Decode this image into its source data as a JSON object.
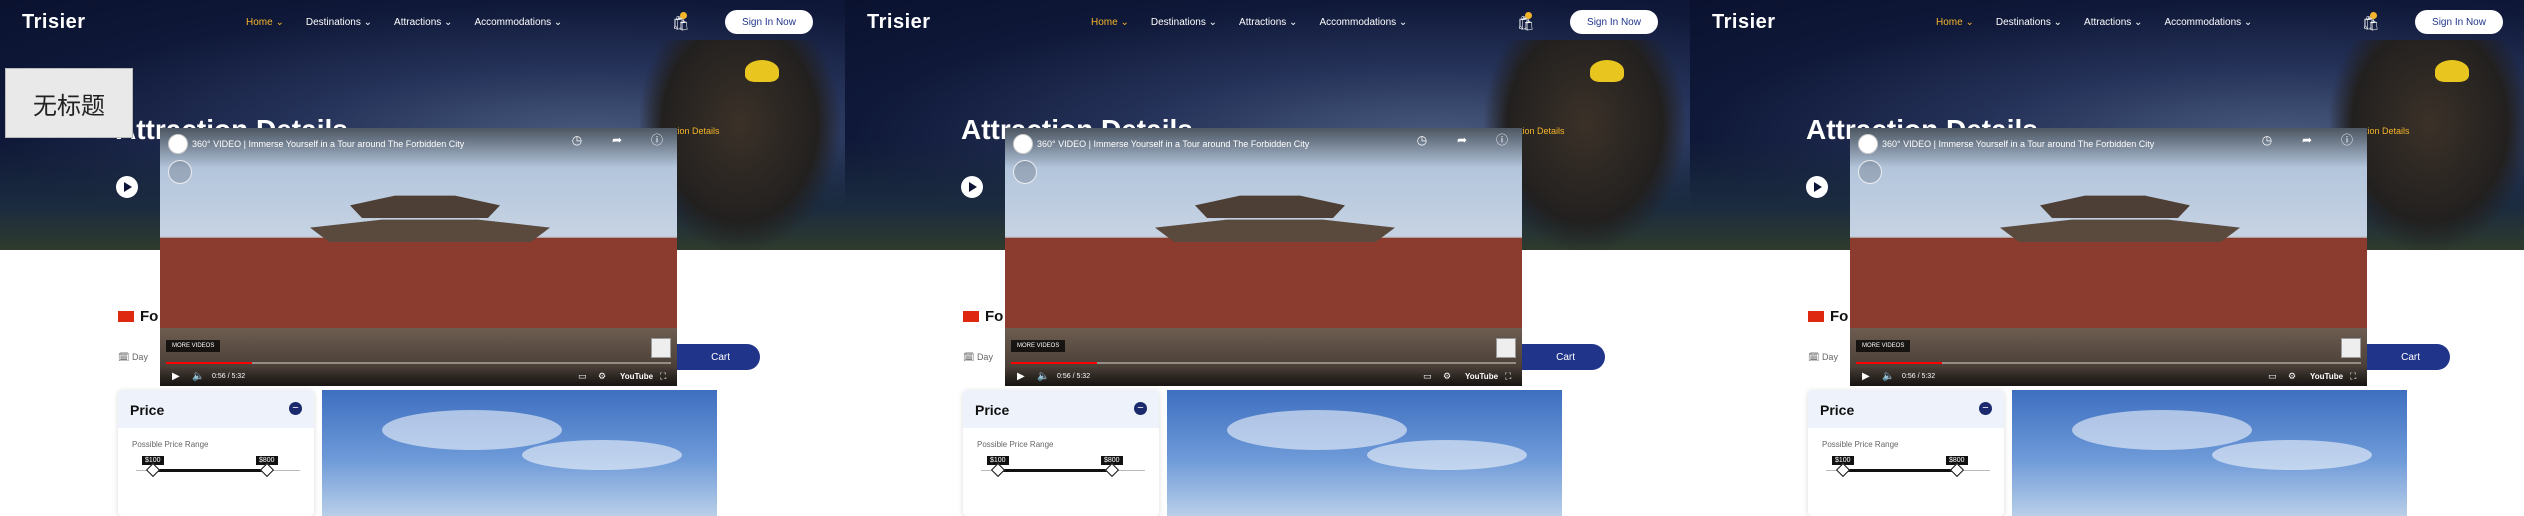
{
  "app": {
    "logo": "Trisier",
    "nav": [
      {
        "label": "Home ⌄",
        "active": true
      },
      {
        "label": "Destinations ⌄",
        "active": false
      },
      {
        "label": "Attractions ⌄",
        "active": false
      },
      {
        "label": "Accommodations ⌄",
        "active": false
      }
    ],
    "sign_in": "Sign In Now",
    "hero_title": "Attraction Details",
    "breadcrumb": "tion Details",
    "section_title": "Fo",
    "meta_day": "Day",
    "add_cart": "Cart",
    "price": {
      "title": "Price",
      "range_label": "Possible Price Range",
      "min_tag": "$100",
      "max_tag": "$800"
    }
  },
  "video": {
    "title": "360° VIDEO | Immerse Yourself in a Tour around The Forbidden City",
    "controls": [
      {
        "icon": "clock-icon",
        "label": "Watch later"
      },
      {
        "icon": "share-icon",
        "label": "Share"
      },
      {
        "icon": "info-icon",
        "label": "Info"
      }
    ],
    "more_videos": "MORE VIDEOS",
    "youtube": "YouTube",
    "times": [
      "0:56 / 5:32",
      "0:56 / 5:32",
      "0:56 / 5:32"
    ]
  },
  "overlay_label": "无标题",
  "colors": {
    "accent": "#f5b52a",
    "brand_blue": "#20348a",
    "hero_bg": "#0f1838"
  }
}
